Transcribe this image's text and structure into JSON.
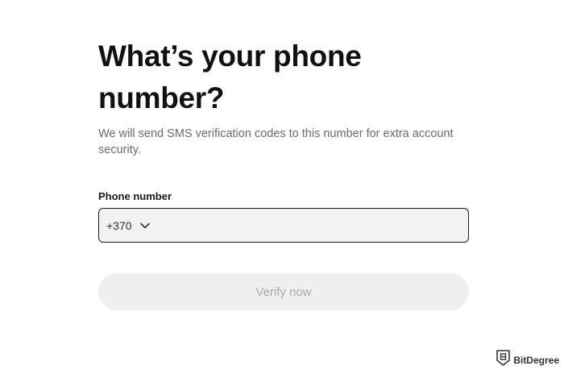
{
  "heading": {
    "title": "What’s your phone number?",
    "subtitle": "We will send SMS verification codes to this number for extra account security."
  },
  "form": {
    "phone_label": "Phone number",
    "country_code": "+370",
    "phone_value": "",
    "dropdown_icon": "chevron-down-icon"
  },
  "actions": {
    "verify_label": "Verify now",
    "verify_enabled": false
  },
  "watermark": {
    "text": "BitDegree",
    "icon": "bitdegree-logo-icon"
  },
  "colors": {
    "input_border": "#1c1c1c",
    "input_background": "#f2f2f2",
    "button_background_disabled": "#efefef",
    "button_text_disabled": "#a8a8a8",
    "subtitle_text": "#6b6b6b"
  }
}
